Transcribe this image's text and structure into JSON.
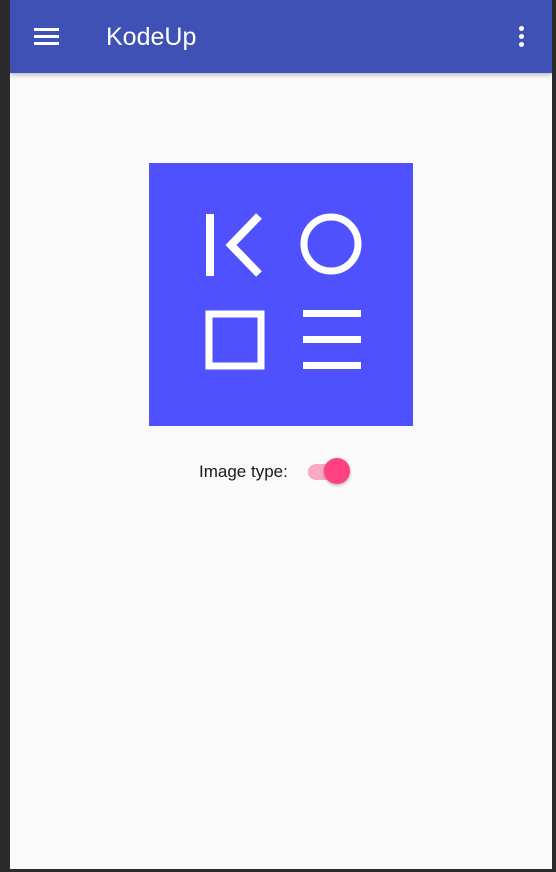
{
  "app_bar": {
    "title": "KodeUp",
    "menu_icon": "hamburger-menu-icon",
    "overflow_icon": "more-vert-icon",
    "color": "#3f51b5"
  },
  "logo": {
    "name": "kodeup-logo",
    "background_color": "#4f50fe",
    "glyph_color": "#ffffff"
  },
  "image_type": {
    "label": "Image type:",
    "switch_on": true,
    "thumb_color": "#ff4081",
    "track_color": "#f8a9c6"
  }
}
